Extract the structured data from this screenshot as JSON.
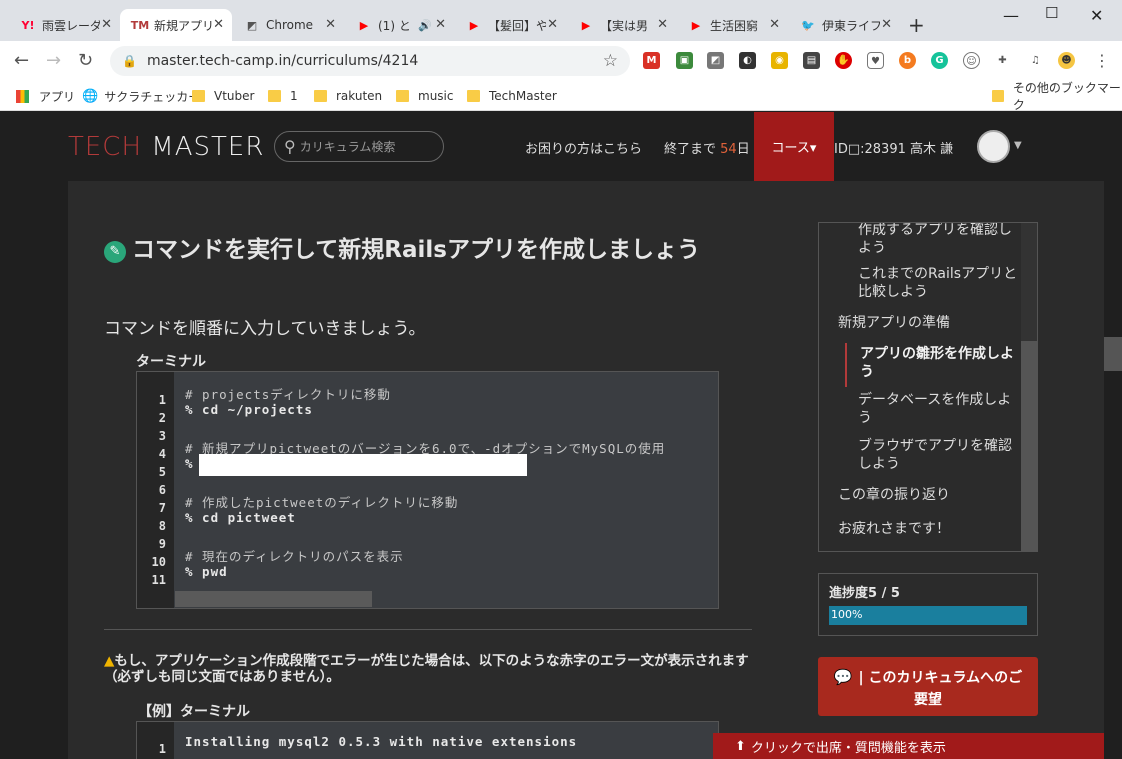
{
  "tabs": [
    {
      "label": "雨雲レーダ",
      "icon": "Y!",
      "icon_color": "#ff0033"
    },
    {
      "label": "新規アプリ",
      "icon": "TM",
      "icon_color": "#b23a3a"
    },
    {
      "label": "Chrome",
      "icon": "◩",
      "icon_color": "#555555"
    },
    {
      "label": "(1) と",
      "icon": "▶",
      "icon_color": "#ff0000"
    },
    {
      "label": "【髪回】や",
      "icon": "▶",
      "icon_color": "#ff0000"
    },
    {
      "label": "【実は男",
      "icon": "▶",
      "icon_color": "#ff0000"
    },
    {
      "label": "生活困窮",
      "icon": "▶",
      "icon_color": "#ff0000"
    },
    {
      "label": "伊東ライフ",
      "icon": "🐦",
      "icon_color": "#1da1f2"
    }
  ],
  "toolbar": {
    "url": "master.tech-camp.in/curriculums/4214"
  },
  "bookmarks": [
    "アプリ",
    "サクラチェッカー",
    "Vtuber",
    "1",
    "rakuten",
    "music",
    "TechMaster",
    "その他のブックマーク"
  ],
  "header": {
    "logo_a": "TECH",
    "logo_b": " MASTER",
    "search_placeholder": "カリキュラム検索",
    "help": "お困りの方はこちら",
    "remain_prefix": "終了まで",
    "remain_days": "54",
    "remain_suffix": "日",
    "course": "コース▾",
    "user": "ID□:28391 高木 謙"
  },
  "content": {
    "title": "コマンドを実行して新規Railsアプリを作成しましょう",
    "lead": "コマンドを順番に入力していきましょう。",
    "terminal_label": "ターミナル",
    "lines": [
      {
        "n": "1",
        "text": "# projectsディレクトリに移動",
        "type": "cm"
      },
      {
        "n": "2",
        "text": "% cd ~/projects",
        "type": "b"
      },
      {
        "n": "3",
        "text": "",
        "type": ""
      },
      {
        "n": "4",
        "text": "# 新規アプリpictweetのバージョンを6.0で、-dオプションでMySQLの使用",
        "type": "cm"
      },
      {
        "n": "5",
        "text": "%",
        "type": "b"
      },
      {
        "n": "6",
        "text": "",
        "type": ""
      },
      {
        "n": "7",
        "text": "# 作成したpictweetのディレクトリに移動",
        "type": "cm"
      },
      {
        "n": "8",
        "text": "% cd pictweet",
        "type": "b"
      },
      {
        "n": "9",
        "text": "",
        "type": ""
      },
      {
        "n": "10",
        "text": "# 現在のディレクトリのパスを表示",
        "type": "cm"
      },
      {
        "n": "11",
        "text": "% pwd",
        "type": "b"
      }
    ],
    "warning": "もし、アプリケーション作成段階でエラーが生じた場合は、以下のような赤字のエラー文が表示されます（必ずしも同じ文面ではありません）。",
    "example_label": "【例】ターミナル",
    "example_line_no": "1",
    "example_line": "Installing mysql2 0.5.3 with native extensions"
  },
  "toc": [
    "作成するアプリを確認しよう",
    "これまでのRailsアプリと比較しよう",
    "新規アプリの準備",
    "アプリの雛形を作成しよう",
    "データベースを作成しよう",
    "ブラウザでアプリを確認しよう",
    "この章の振り返り",
    "お疲れさまです！"
  ],
  "progress": {
    "label": "進捗度5 / 5",
    "value": "100%",
    "fraction": 1.0
  },
  "request": {
    "line1": "| このカリキュラムへのご",
    "line2": "要望"
  },
  "footer": "クリックで出席・質問機能を表示"
}
